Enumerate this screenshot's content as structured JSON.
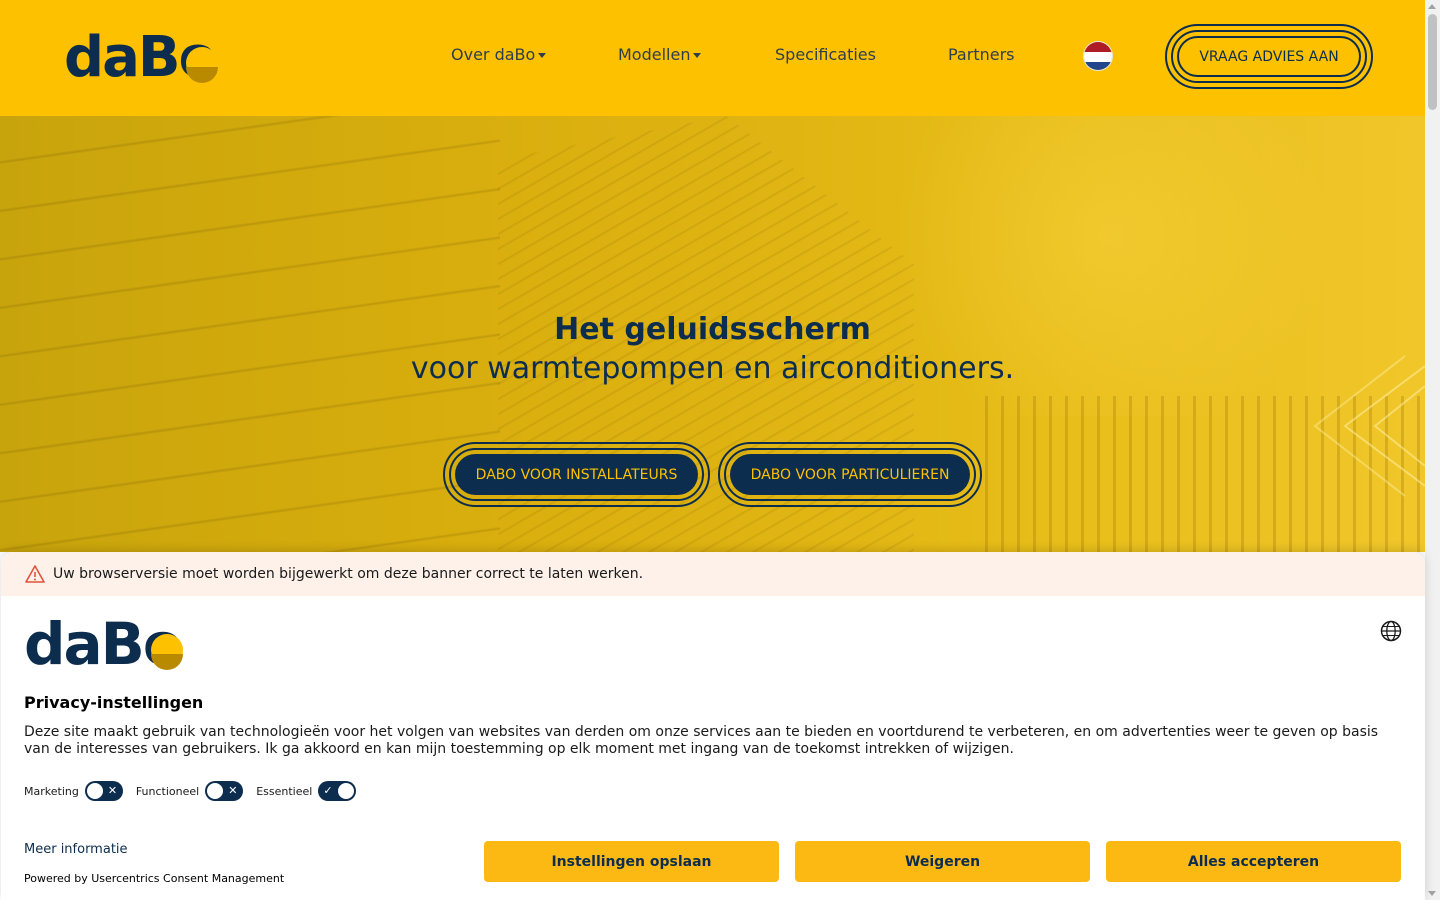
{
  "header": {
    "logo": "daBo",
    "nav": [
      {
        "label": "Over daBo",
        "dropdown": true
      },
      {
        "label": "Modellen",
        "dropdown": true
      },
      {
        "label": "Specificaties",
        "dropdown": false
      },
      {
        "label": "Partners",
        "dropdown": false
      }
    ],
    "language_flag": "netherlands-flag-icon",
    "cta_label": "VRAAG ADVIES AAN"
  },
  "hero": {
    "title": "Het geluidsscherm",
    "subtitle": "voor warmtepompen en airconditioners.",
    "buttons": [
      "DABO VOOR INSTALLATEURS",
      "DABO VOOR PARTICULIEREN"
    ]
  },
  "consent": {
    "warning": "Uw browserversie moet worden bijgewerkt om deze banner correct te laten werken.",
    "logo": "daBo",
    "title": "Privacy-instellingen",
    "description": "Deze site maakt gebruik van technologieën voor het volgen van websites van derden om onze services aan te bieden en voortdurend te verbeteren, en om advertenties weer te geven op basis van de interesses van gebruikers. Ik ga akkoord en kan mijn toestemming op elk moment met ingang van de toekomst intrekken of wijzigen.",
    "toggles": [
      {
        "label": "Marketing",
        "on": false
      },
      {
        "label": "Functioneel",
        "on": false
      },
      {
        "label": "Essentieel",
        "on": true
      }
    ],
    "more_info": "Meer informatie",
    "powered_by": "Powered by Usercentrics Consent Management",
    "buttons": {
      "save": "Instellingen opslaan",
      "deny": "Weigeren",
      "accept": "Alles accepteren"
    }
  },
  "colors": {
    "brand_yellow": "#fdc100",
    "brand_navy": "#0c2d4e",
    "button_yellow": "#fdb913",
    "warning_bg": "#fef1ea"
  }
}
